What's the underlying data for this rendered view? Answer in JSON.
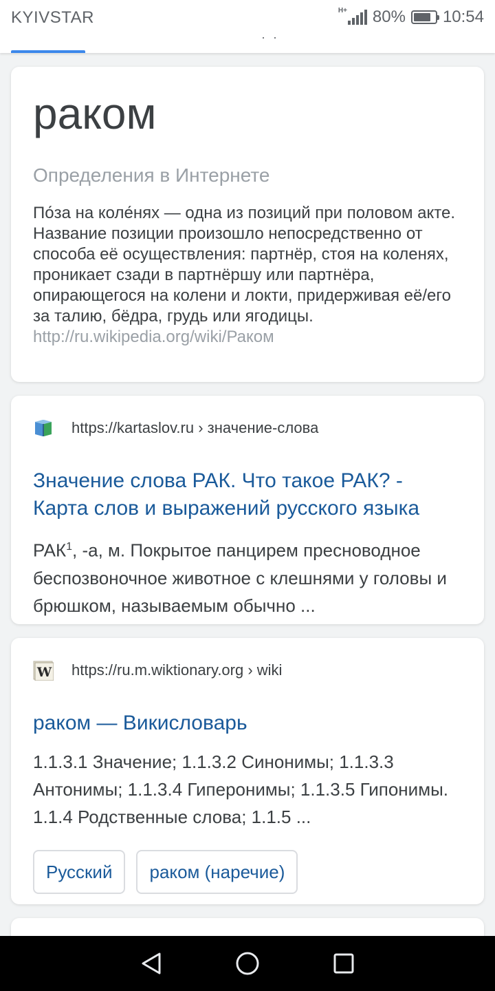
{
  "status_bar": {
    "carrier": "KYIVSTAR",
    "network": "H+",
    "battery": "80%",
    "time": "10:54"
  },
  "tab_strip": {
    "dots": "· ·"
  },
  "definition": {
    "title": "раком",
    "subtitle": "Определения в Интернете",
    "text": "По́за на коле́нях — одна из позиций при половом акте. Название позиции произошло непосредственно от способа её осуществления: партнёр, стоя на коленях, проникает сзади в партнёршу или партнёра, опирающегося на колени и локти, придерживая её/его за талию, бёдра, грудь или ягодицы.",
    "link": "http://ru.wikipedia.org/wiki/Раком"
  },
  "results": [
    {
      "favicon": "book-icon",
      "url": "https://kartaslov.ru › значение-слова",
      "title": "Значение слова РАК. Что такое РАК? - Карта слов и выражений русского языка",
      "snippet_start": "РАК",
      "snippet_sup": "1",
      "snippet_rest": ", -а, м. Покрытое панцирем пресноводное беспозвоночное животное с клешнями у головы и брюшком, называемым обычно ..."
    },
    {
      "favicon": "wiktionary-icon",
      "favicon_letter": "W",
      "url": "https://ru.m.wiktionary.org › wiki",
      "title": "раком — Викисловарь",
      "snippet": "1.1.3.1 Значение; 1.1.3.2 Синонимы; 1.1.3.3 Антонимы; 1.1.3.4 Гиперонимы; 1.1.3.5 Гипонимы. 1.1.4 Родственные слова; 1.1.5 ...",
      "chips": [
        "Русский",
        "раком (наречие)"
      ]
    }
  ],
  "nav_bar": {
    "icons": [
      "back-triangle-icon",
      "home-circle-icon",
      "recents-square-icon"
    ]
  },
  "colors": {
    "link": "#1a5a9a",
    "muted": "#9aa0a6",
    "text": "#3c4043",
    "accent": "#1a73e8",
    "background": "#f1f3f4"
  }
}
